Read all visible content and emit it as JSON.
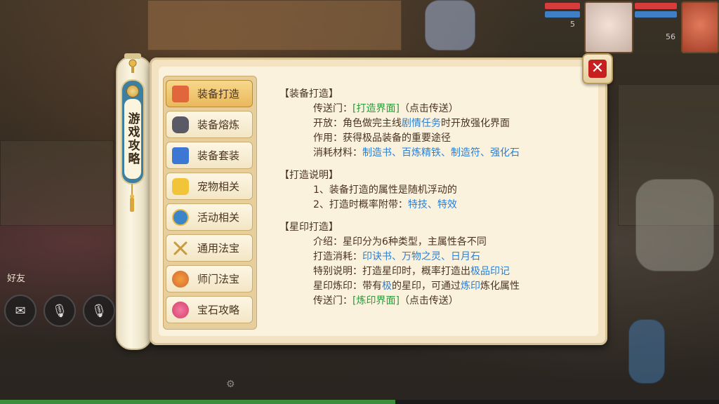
{
  "hud": {
    "pet_level": "5",
    "player_level": "56",
    "friend_label": "好友",
    "colors": {
      "hp": "#d63c3c",
      "mp": "#3f7fc6",
      "exp": "#3c8d3c"
    }
  },
  "scroll": {
    "title": "游戏攻略"
  },
  "nav": {
    "items": [
      {
        "label": "装备打造",
        "icon": "forge-flame-icon",
        "color": "#e2663b",
        "active": true
      },
      {
        "label": "装备熔炼",
        "icon": "ore-stone-icon",
        "color": "#5a5a66",
        "active": false
      },
      {
        "label": "装备套装",
        "icon": "armor-set-icon",
        "color": "#3d77d4",
        "active": false
      },
      {
        "label": "宠物相关",
        "icon": "pet-face-icon",
        "color": "#f2c43a",
        "active": false
      },
      {
        "label": "活动相关",
        "icon": "activity-badge-icon",
        "color": "#3a86c9",
        "active": false
      },
      {
        "label": "通用法宝",
        "icon": "crossed-swords-icon",
        "color": "#c89b3c",
        "active": false
      },
      {
        "label": "师门法宝",
        "icon": "gourd-treasure-icon",
        "color": "#d4663a",
        "active": false
      },
      {
        "label": "宝石攻略",
        "icon": "gem-orb-icon",
        "color": "#d63c6b",
        "active": false
      }
    ]
  },
  "content": {
    "forge": {
      "title": "【装备打造】",
      "portal_prefix": "传送门：",
      "portal_link": "[打造界面]",
      "portal_suffix": "（点击传送）",
      "open_prefix": "开放：角色做完主线",
      "open_link": "剧情任务",
      "open_suffix": "时开放强化界面",
      "use": "作用：获得极品装备的重要途径",
      "mat_prefix": "消耗材料：",
      "mat_1": "制造书",
      "sep_1": "、",
      "mat_2": "百炼精铁",
      "sep_2": "、",
      "mat_3": "制造符",
      "sep_3": "、",
      "mat_4": "强化石"
    },
    "notes": {
      "title": "【打造说明】",
      "line_1": "1、装备打造的属性是随机浮动的",
      "line_2_prefix": "2、打造时概率附带：",
      "line_2_a": "特技",
      "line_2_sep": "、",
      "line_2_b": "特效"
    },
    "star": {
      "title": "【星印打造】",
      "intro": "介绍：星印分为6种类型，主属性各不同",
      "cost_prefix": "打造消耗：",
      "cost_1": "印诀书",
      "cost_sep_1": "、",
      "cost_2": "万物之灵",
      "cost_sep_2": "、",
      "cost_3": "日月石",
      "special_prefix": "特别说明：打造星印时，概率打造出",
      "special_link": "极品印记",
      "refine_prefix": "星印炼印：带有",
      "refine_ji": "极",
      "refine_mid": "的星印，可通过",
      "refine_link": "炼印",
      "refine_suffix": "炼化属性",
      "portal_prefix": "传送门：",
      "portal_link": "[炼印界面]",
      "portal_suffix": "（点击传送）"
    }
  }
}
